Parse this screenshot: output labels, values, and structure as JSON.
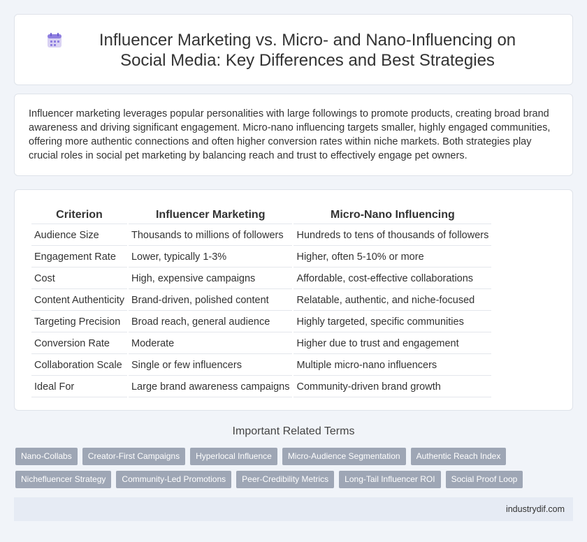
{
  "header": {
    "icon": "calendar-icon",
    "title": "Influencer Marketing vs. Micro- and Nano-Influencing on Social Media: Key Differences and Best Strategies"
  },
  "intro": {
    "text": "Influencer marketing leverages popular personalities with large followings to promote products, creating broad brand awareness and driving significant engagement. Micro-nano influencing targets smaller, highly engaged communities, offering more authentic connections and often higher conversion rates within niche markets. Both strategies play crucial roles in social pet marketing by balancing reach and trust to effectively engage pet owners."
  },
  "table": {
    "headers": [
      "Criterion",
      "Influencer Marketing",
      "Micro-Nano Influencing"
    ],
    "rows": [
      [
        "Audience Size",
        "Thousands to millions of followers",
        "Hundreds to tens of thousands of followers"
      ],
      [
        "Engagement Rate",
        "Lower, typically 1-3%",
        "Higher, often 5-10% or more"
      ],
      [
        "Cost",
        "High, expensive campaigns",
        "Affordable, cost-effective collaborations"
      ],
      [
        "Content Authenticity",
        "Brand-driven, polished content",
        "Relatable, authentic, and niche-focused"
      ],
      [
        "Targeting Precision",
        "Broad reach, general audience",
        "Highly targeted, specific communities"
      ],
      [
        "Conversion Rate",
        "Moderate",
        "Higher due to trust and engagement"
      ],
      [
        "Collaboration Scale",
        "Single or few influencers",
        "Multiple micro-nano influencers"
      ],
      [
        "Ideal For",
        "Large brand awareness campaigns",
        "Community-driven brand growth"
      ]
    ]
  },
  "related": {
    "title": "Important Related Terms",
    "rows": [
      [
        "Nano-Collabs",
        "Creator-First Campaigns",
        "Hyperlocal Influence",
        "Micro-Audience Segmentation",
        "Authentic Reach Index"
      ],
      [
        "Nichefluencer Strategy",
        "Community-Led Promotions",
        "Peer-Credibility Metrics",
        "Long-Tail Influencer ROI",
        "Social Proof Loop"
      ]
    ]
  },
  "footer": {
    "site": "industrydif.com"
  }
}
